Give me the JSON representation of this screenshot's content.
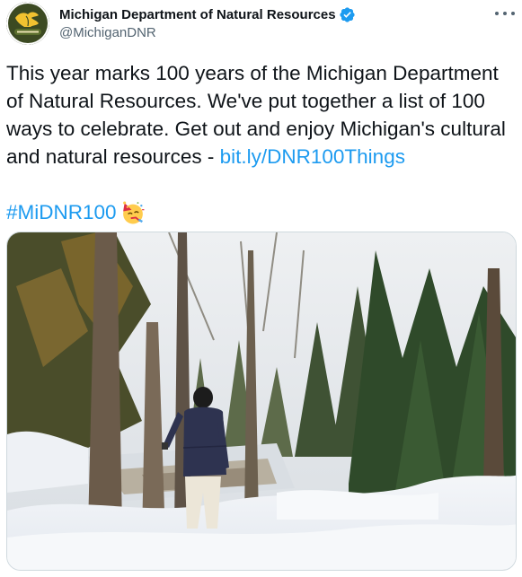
{
  "tweet": {
    "author": {
      "display_name": "Michigan Department of Natural Resources",
      "handle": "@MichiganDNR",
      "verified": true,
      "verified_icon": "verified-badge-icon",
      "avatar_icon": "michigan-dnr-logo"
    },
    "more_icon": "more-options-icon",
    "text": {
      "body": "This year marks 100 years of the Michigan Department of Natural Resources. We've put together a list of 100 ways to celebrate. Get out and enjoy Michigan's cultural and natural resources - ",
      "link": "bit.ly/DNR100Things",
      "hashtag": "#MiDNR100",
      "emoji": "party-face-emoji"
    },
    "media": {
      "type": "photo",
      "subject": "hiker-in-snowy-forest-by-waterfall"
    }
  },
  "colors": {
    "text": "#0f1419",
    "secondary": "#536471",
    "link": "#1d9bf0",
    "verified": "#1d9bf0"
  }
}
